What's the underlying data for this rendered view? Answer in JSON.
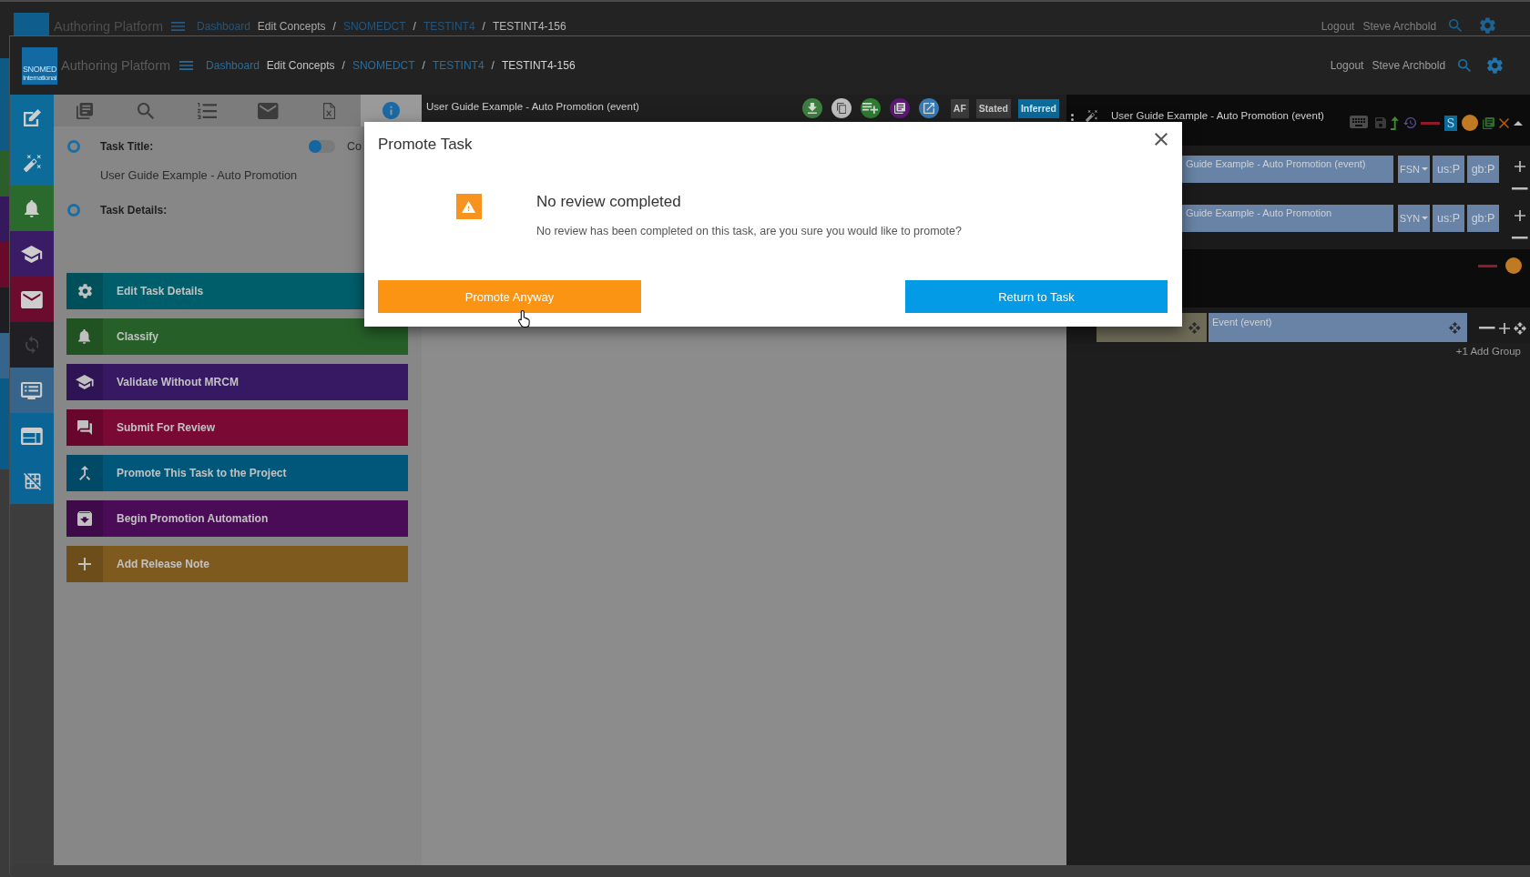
{
  "background_window": {
    "app_name": "Authoring Platform",
    "breadcrumb": [
      {
        "label": "Dashboard",
        "kind": "link"
      },
      {
        "label": "Edit Concepts",
        "kind": "text"
      },
      {
        "label": "/",
        "kind": "separator"
      },
      {
        "label": "SNOMEDCT",
        "kind": "link"
      },
      {
        "label": "/",
        "kind": "separator"
      },
      {
        "label": "TESTINT4",
        "kind": "link"
      },
      {
        "label": "/",
        "kind": "separator"
      },
      {
        "label": "TESTINT4-156",
        "kind": "current"
      }
    ],
    "user_links": [
      "Logout",
      "Steve Archbold"
    ]
  },
  "header": {
    "logo_lines": [
      "SNOMED",
      "International"
    ],
    "app_name": "Authoring Platform",
    "breadcrumb": [
      {
        "label": "Dashboard",
        "kind": "link"
      },
      {
        "label": "Edit Concepts",
        "kind": "text"
      },
      {
        "label": "/",
        "kind": "separator"
      },
      {
        "label": "SNOMEDCT",
        "kind": "link"
      },
      {
        "label": "/",
        "kind": "separator"
      },
      {
        "label": "TESTINT4",
        "kind": "link"
      },
      {
        "label": "/",
        "kind": "separator"
      },
      {
        "label": "TESTINT4-156",
        "kind": "current"
      }
    ],
    "user_links": [
      "Logout",
      "Steve Archbold"
    ]
  },
  "sidebar": {
    "items": [
      {
        "color": "#0c6b99"
      },
      {
        "color": "#0c6b99"
      },
      {
        "color": "#2a6a2c"
      },
      {
        "color": "#3a1b66"
      },
      {
        "color": "#6b0b2e"
      },
      {
        "color": "#1f1f24"
      },
      {
        "color": "#36648b"
      },
      {
        "color": "#0a6596"
      },
      {
        "color": "#0a6596"
      }
    ]
  },
  "task_panel": {
    "tabs": [
      {
        "selected": false
      },
      {
        "selected": false
      },
      {
        "selected": false
      },
      {
        "selected": false
      },
      {
        "selected": false
      },
      {
        "selected": true
      }
    ],
    "fields": [
      {
        "label": "Task Title:",
        "value": "User Guide Example - Auto Promotion"
      },
      {
        "label": "Task Details:"
      }
    ],
    "toggle": {
      "on": false,
      "label": "Co"
    },
    "actions": [
      {
        "label": "Edit Task Details",
        "color": "#005e6a"
      },
      {
        "label": "Classify",
        "color": "#266028"
      },
      {
        "label": "Validate Without MRCM",
        "color": "#361863"
      },
      {
        "label": "Submit For Review",
        "color": "#7a0933"
      },
      {
        "label": "Promote This Task to the Project",
        "color": "#005779"
      },
      {
        "label": "Begin Promotion Automation",
        "color": "#4a0c56"
      },
      {
        "label": "Add Release Note",
        "color": "#7f5a1e"
      }
    ]
  },
  "concept_editor": {
    "title": "User Guide Example - Auto Promotion (event)",
    "tool_buttons": [
      {
        "color": "#3e7d40"
      },
      {
        "color": "#bdbdbd"
      },
      {
        "color": "#2f7a33"
      },
      {
        "color": "#5b1a72"
      },
      {
        "color": "#3a78b2"
      }
    ],
    "view_buttons": [
      {
        "label": "AF",
        "selected": false
      },
      {
        "label": "Stated",
        "selected": false
      },
      {
        "label": "Inferred",
        "selected": true
      }
    ]
  },
  "concept_panel": {
    "title": "User Guide Example - Auto Promotion (event)",
    "status_badge": "S",
    "descriptions": [
      {
        "term": "Guide Example - Auto Promotion (event)",
        "type": "FSN",
        "acceptability": [
          "us:P",
          "gb:P"
        ]
      },
      {
        "term": "Guide Example - Auto Promotion",
        "type": "SYN",
        "acceptability": [
          "us:P",
          "gb:P"
        ]
      }
    ],
    "relationships": [
      {
        "target": "Event (event)"
      }
    ],
    "add_group": "+1 Add Group"
  },
  "dialog": {
    "title": "Promote Task",
    "heading": "No review completed",
    "message": "No review has been completed on this task, are you sure you would like to promote?",
    "buttons": [
      {
        "label": "Promote Anyway",
        "kind": "warning"
      },
      {
        "label": "Return to Task",
        "kind": "primary"
      }
    ]
  }
}
